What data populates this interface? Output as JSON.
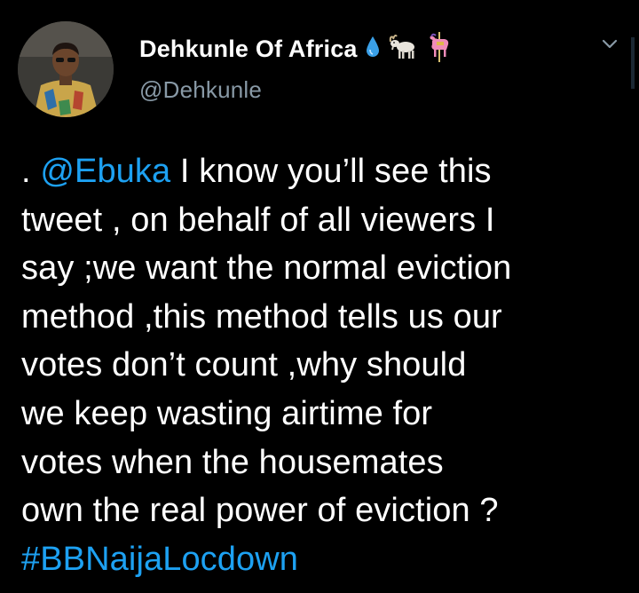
{
  "author": {
    "display_name": "Dehkunle Of Africa",
    "handle": "@Dehkunle",
    "name_emojis": [
      "droplet-emoji",
      "goat-emoji",
      "carousel-horse-emoji"
    ]
  },
  "tweet": {
    "prefix": ". ",
    "mention": "@Ebuka",
    "body": " I know you’ll see this\ntweet , on behalf of all viewers I\nsay ;we want the normal eviction\nmethod ,this method tells us our\nvotes don’t count ,why should\nwe keep wasting airtime for\nvotes when the housemates\nown the real power of eviction ?\n",
    "hashtag": "#BBNaijaLocdown"
  },
  "colors": {
    "background": "#000000",
    "text": "#ffffff",
    "secondary_text": "#8899a6",
    "link": "#1da1f2"
  },
  "icons": {
    "menu": "chevron-down-icon"
  }
}
